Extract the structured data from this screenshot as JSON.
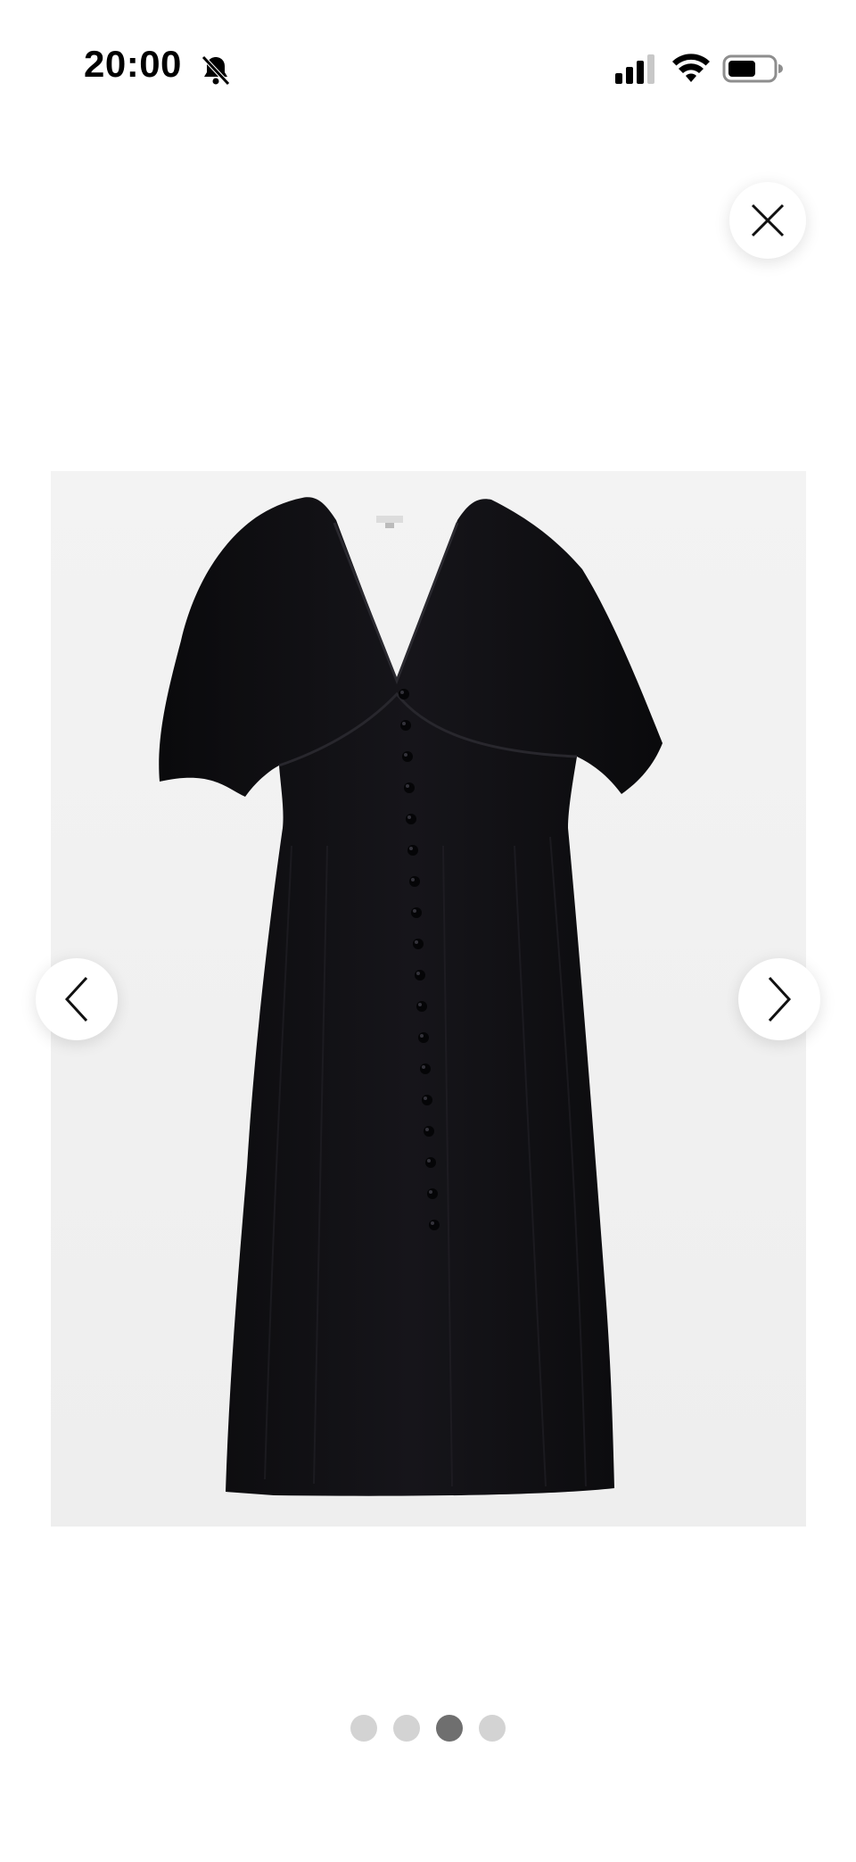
{
  "status_bar": {
    "time": "20:00",
    "icons": [
      "bell-slash-icon",
      "cellular-signal-icon",
      "wifi-icon",
      "battery-icon"
    ]
  },
  "gallery": {
    "image": "black-button-front-midi-dress",
    "current_index": 3,
    "total": 4,
    "colors": {
      "dot_active": "#6f6f6f",
      "dot_inactive": "#d3d3d3",
      "background": "#f2f2f2"
    }
  },
  "controls": {
    "close_icon": "close-icon",
    "prev_icon": "chevron-left-icon",
    "next_icon": "chevron-right-icon"
  }
}
